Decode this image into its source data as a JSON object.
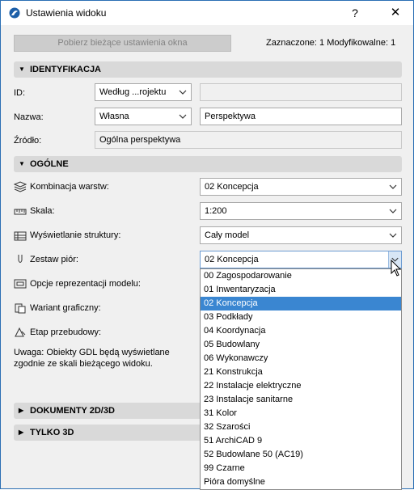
{
  "window": {
    "title": "Ustawienia widoku",
    "help": "?",
    "close": "✕"
  },
  "toolbar": {
    "fetch_button": "Pobierz bieżące ustawienia okna",
    "status": "Zaznaczone: 1 Modyfikowalne: 1"
  },
  "sections": {
    "identification": "IDENTYFIKACJA",
    "general": "OGÓLNE",
    "docs": "DOKUMENTY 2D/3D",
    "only3d": "TYLKO 3D"
  },
  "identification": {
    "id_label": "ID:",
    "id_combo": "Według ...rojektu",
    "id_value": "",
    "name_label": "Nazwa:",
    "name_combo": "Własna",
    "name_value": "Perspektywa",
    "source_label": "Źródło:",
    "source_value": "Ogólna perspektywa"
  },
  "general": {
    "layers_label": "Kombinacja warstw:",
    "layers_value": "02 Koncepcja",
    "scale_label": "Skala:",
    "scale_value": "1:200",
    "structure_label": "Wyświetlanie struktury:",
    "structure_value": "Cały model",
    "pens_label": "Zestaw piór:",
    "pens_value": "02 Koncepcja",
    "model_label": "Opcje reprezentacji modelu:",
    "graphic_label": "Wariant graficzny:",
    "renovation_label": "Etap przebudowy:",
    "note": "Uwaga: Obiekty GDL będą wyświetlane zgodnie ze skali bieżącego widoku."
  },
  "pen_options": [
    "00 Zagospodarowanie",
    "01 Inwentaryzacja",
    "02 Koncepcja",
    "03 Podkłady",
    "04 Koordynacja",
    "05 Budowlany",
    "06 Wykonawczy",
    "21 Konstrukcja",
    "22 Instalacje elektryczne",
    "23 Instalacje sanitarne",
    "31 Kolor",
    "32 Szarości",
    "51 ArchiCAD 9",
    "52 Budowlane 50 (AC19)",
    "99 Czarne",
    "Pióra domyślne"
  ],
  "colors": {
    "selection": "#3a86d1",
    "section_bg": "#d9d9d9",
    "window_border": "#2b6fb4"
  }
}
